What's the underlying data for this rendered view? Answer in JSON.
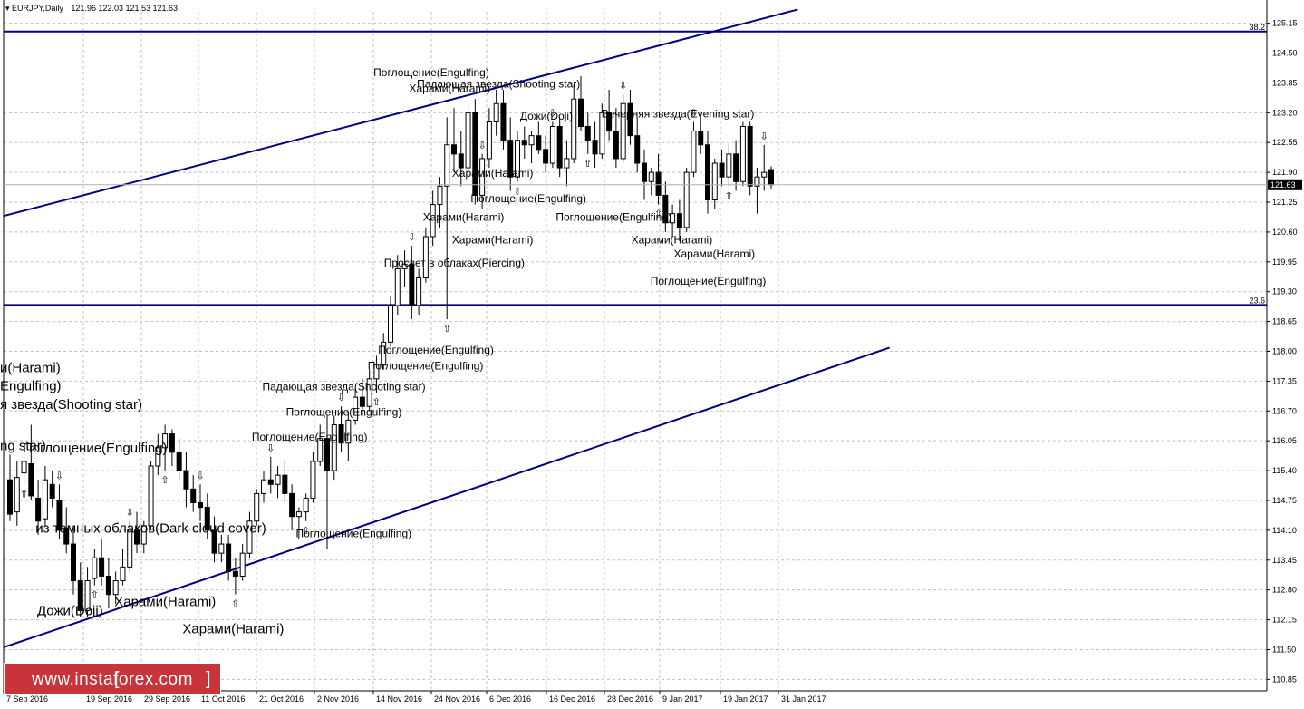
{
  "header": {
    "title": "EURJPY,Daily",
    "ohlc": "121.96 122.03 121.53 121.63"
  },
  "watermark": {
    "text": "www.instaforex.com",
    "left_bracket": "[",
    "right_bracket": "]"
  },
  "colors": {
    "bull": "#ffffff",
    "bear": "#000000",
    "line": "#000080",
    "grid": "#c0c0c0",
    "price_tag": "#000000"
  },
  "chart_data": {
    "type": "candlestick",
    "symbol": "EURJPY",
    "timeframe": "Daily",
    "ylim": [
      110.85,
      125.45
    ],
    "y_ticks": [
      "125.15",
      "124.50",
      "123.85",
      "123.20",
      "122.55",
      "121.90",
      "121.25",
      "120.60",
      "119.95",
      "119.30",
      "118.65",
      "118.00",
      "117.35",
      "116.70",
      "116.05",
      "115.40",
      "114.75",
      "114.10",
      "113.45",
      "112.80",
      "112.15",
      "111.50",
      "110.85"
    ],
    "x_labels": [
      "7 Sep 2016",
      "19 Sep 2016",
      "29 Sep 2016",
      "11 Oct 2016",
      "21 Oct 2016",
      "2 Nov 2016",
      "14 Nov 2016",
      "24 Nov 2016",
      "6 Dec 2016",
      "16 Dec 2016",
      "28 Dec 2016",
      "9 Jan 2017",
      "19 Jan 2017",
      "31 Jan 2017"
    ],
    "current_price": "121.63",
    "grid": true,
    "horizontal_levels": [
      {
        "label": "38.2",
        "price": 124.97
      },
      {
        "label": "23.6",
        "price": 119.01
      }
    ],
    "trend_lines": [
      {
        "from": [
          "7 Sep 2016",
          120.95
        ],
        "to": [
          "4 Feb 2017",
          125.45
        ],
        "name": "channel-upper"
      },
      {
        "from": [
          "7 Sep 2016",
          111.55
        ],
        "to": [
          "23 Feb 2017",
          118.08
        ],
        "name": "channel-lower"
      }
    ],
    "candles": [
      {
        "o": 115.2,
        "h": 115.75,
        "l": 114.3,
        "c": 114.45
      },
      {
        "o": 114.5,
        "h": 115.6,
        "l": 114.2,
        "c": 115.25
      },
      {
        "o": 115.35,
        "h": 116.05,
        "l": 115.1,
        "c": 115.6
      },
      {
        "o": 115.55,
        "h": 116.4,
        "l": 114.75,
        "c": 114.85
      },
      {
        "o": 114.8,
        "h": 115.2,
        "l": 114.0,
        "c": 114.3
      },
      {
        "o": 114.35,
        "h": 115.5,
        "l": 114.2,
        "c": 115.2
      },
      {
        "o": 115.1,
        "h": 115.4,
        "l": 114.6,
        "c": 114.8
      },
      {
        "o": 114.75,
        "h": 115.1,
        "l": 113.9,
        "c": 114.1
      },
      {
        "o": 114.15,
        "h": 114.6,
        "l": 113.6,
        "c": 113.8
      },
      {
        "o": 113.8,
        "h": 114.2,
        "l": 112.7,
        "c": 113.0
      },
      {
        "o": 113.0,
        "h": 113.4,
        "l": 112.2,
        "c": 112.35
      },
      {
        "o": 112.35,
        "h": 113.3,
        "l": 112.2,
        "c": 113.0
      },
      {
        "o": 113.05,
        "h": 113.7,
        "l": 112.9,
        "c": 113.5
      },
      {
        "o": 113.5,
        "h": 113.9,
        "l": 112.9,
        "c": 113.1
      },
      {
        "o": 113.1,
        "h": 113.5,
        "l": 112.4,
        "c": 112.7
      },
      {
        "o": 112.7,
        "h": 113.2,
        "l": 112.5,
        "c": 113.0
      },
      {
        "o": 113.0,
        "h": 113.7,
        "l": 112.9,
        "c": 113.3
      },
      {
        "o": 113.3,
        "h": 114.3,
        "l": 113.2,
        "c": 114.1
      },
      {
        "o": 114.1,
        "h": 114.5,
        "l": 113.6,
        "c": 113.8
      },
      {
        "o": 113.8,
        "h": 114.3,
        "l": 113.6,
        "c": 114.2
      },
      {
        "o": 114.2,
        "h": 115.6,
        "l": 114.1,
        "c": 115.5
      },
      {
        "o": 115.5,
        "h": 116.2,
        "l": 115.3,
        "c": 115.9
      },
      {
        "o": 115.9,
        "h": 116.4,
        "l": 115.4,
        "c": 116.2
      },
      {
        "o": 116.2,
        "h": 116.3,
        "l": 115.5,
        "c": 115.8
      },
      {
        "o": 115.8,
        "h": 116.1,
        "l": 115.2,
        "c": 115.4
      },
      {
        "o": 115.4,
        "h": 115.8,
        "l": 114.6,
        "c": 115.0
      },
      {
        "o": 115.0,
        "h": 115.3,
        "l": 114.5,
        "c": 114.7
      },
      {
        "o": 114.7,
        "h": 115.1,
        "l": 114.3,
        "c": 114.6
      },
      {
        "o": 114.6,
        "h": 114.9,
        "l": 113.9,
        "c": 114.1
      },
      {
        "o": 114.1,
        "h": 114.4,
        "l": 113.4,
        "c": 113.6
      },
      {
        "o": 113.6,
        "h": 114.0,
        "l": 113.4,
        "c": 113.8
      },
      {
        "o": 113.8,
        "h": 114.0,
        "l": 113.0,
        "c": 113.2
      },
      {
        "o": 113.2,
        "h": 113.5,
        "l": 112.7,
        "c": 113.1
      },
      {
        "o": 113.1,
        "h": 113.8,
        "l": 113.0,
        "c": 113.6
      },
      {
        "o": 113.6,
        "h": 114.5,
        "l": 113.5,
        "c": 114.3
      },
      {
        "o": 114.3,
        "h": 115.0,
        "l": 114.2,
        "c": 114.9
      },
      {
        "o": 114.9,
        "h": 115.4,
        "l": 114.7,
        "c": 115.2
      },
      {
        "o": 115.2,
        "h": 115.7,
        "l": 114.9,
        "c": 115.1
      },
      {
        "o": 115.1,
        "h": 115.5,
        "l": 114.8,
        "c": 115.3
      },
      {
        "o": 115.3,
        "h": 115.6,
        "l": 114.7,
        "c": 114.9
      },
      {
        "o": 114.9,
        "h": 115.1,
        "l": 114.1,
        "c": 114.4
      },
      {
        "o": 114.4,
        "h": 114.6,
        "l": 113.9,
        "c": 114.5
      },
      {
        "o": 114.5,
        "h": 114.9,
        "l": 114.3,
        "c": 114.8
      },
      {
        "o": 114.8,
        "h": 115.8,
        "l": 114.7,
        "c": 115.6
      },
      {
        "o": 115.6,
        "h": 116.4,
        "l": 115.5,
        "c": 116.1
      },
      {
        "o": 116.1,
        "h": 116.6,
        "l": 113.7,
        "c": 115.4
      },
      {
        "o": 115.4,
        "h": 116.6,
        "l": 115.2,
        "c": 116.4
      },
      {
        "o": 116.4,
        "h": 116.8,
        "l": 115.8,
        "c": 116.0
      },
      {
        "o": 116.0,
        "h": 116.7,
        "l": 115.6,
        "c": 116.5
      },
      {
        "o": 116.5,
        "h": 117.2,
        "l": 116.4,
        "c": 117.0
      },
      {
        "o": 117.0,
        "h": 117.4,
        "l": 116.6,
        "c": 116.8
      },
      {
        "o": 116.8,
        "h": 117.6,
        "l": 116.7,
        "c": 117.4
      },
      {
        "o": 117.4,
        "h": 117.9,
        "l": 117.1,
        "c": 117.7
      },
      {
        "o": 117.7,
        "h": 118.4,
        "l": 117.6,
        "c": 118.2
      },
      {
        "o": 118.2,
        "h": 119.2,
        "l": 118.1,
        "c": 119.0
      },
      {
        "o": 119.0,
        "h": 120.1,
        "l": 118.8,
        "c": 119.8
      },
      {
        "o": 119.8,
        "h": 120.2,
        "l": 119.4,
        "c": 119.9
      },
      {
        "o": 119.9,
        "h": 120.3,
        "l": 118.7,
        "c": 119.0
      },
      {
        "o": 119.0,
        "h": 119.8,
        "l": 118.8,
        "c": 119.6
      },
      {
        "o": 119.6,
        "h": 120.7,
        "l": 119.5,
        "c": 120.5
      },
      {
        "o": 120.5,
        "h": 121.5,
        "l": 120.3,
        "c": 121.2
      },
      {
        "o": 121.2,
        "h": 121.8,
        "l": 120.7,
        "c": 121.6
      },
      {
        "o": 121.6,
        "h": 123.1,
        "l": 118.7,
        "c": 122.5
      },
      {
        "o": 122.5,
        "h": 123.3,
        "l": 121.9,
        "c": 122.3
      },
      {
        "o": 122.3,
        "h": 122.8,
        "l": 121.6,
        "c": 122.0
      },
      {
        "o": 122.0,
        "h": 123.4,
        "l": 121.9,
        "c": 123.2
      },
      {
        "o": 123.2,
        "h": 123.5,
        "l": 121.2,
        "c": 121.4
      },
      {
        "o": 121.4,
        "h": 122.3,
        "l": 121.1,
        "c": 122.2
      },
      {
        "o": 122.2,
        "h": 123.3,
        "l": 122.0,
        "c": 123.0
      },
      {
        "o": 123.0,
        "h": 123.7,
        "l": 122.7,
        "c": 123.4
      },
      {
        "o": 123.4,
        "h": 123.7,
        "l": 122.4,
        "c": 122.6
      },
      {
        "o": 122.6,
        "h": 123.1,
        "l": 121.5,
        "c": 121.8
      },
      {
        "o": 121.8,
        "h": 122.8,
        "l": 121.7,
        "c": 122.6
      },
      {
        "o": 122.6,
        "h": 122.9,
        "l": 122.2,
        "c": 122.5
      },
      {
        "o": 122.5,
        "h": 122.8,
        "l": 122.1,
        "c": 122.7
      },
      {
        "o": 122.7,
        "h": 123.0,
        "l": 122.3,
        "c": 122.4
      },
      {
        "o": 122.4,
        "h": 122.7,
        "l": 121.9,
        "c": 122.1
      },
      {
        "o": 122.1,
        "h": 123.0,
        "l": 122.0,
        "c": 122.9
      },
      {
        "o": 122.9,
        "h": 123.1,
        "l": 121.8,
        "c": 122.0
      },
      {
        "o": 122.0,
        "h": 122.6,
        "l": 121.6,
        "c": 122.2
      },
      {
        "o": 122.2,
        "h": 123.8,
        "l": 122.1,
        "c": 123.5
      },
      {
        "o": 123.5,
        "h": 124.0,
        "l": 122.8,
        "c": 122.9
      },
      {
        "o": 122.9,
        "h": 123.2,
        "l": 122.3,
        "c": 122.6
      },
      {
        "o": 122.6,
        "h": 123.0,
        "l": 122.0,
        "c": 122.3
      },
      {
        "o": 122.3,
        "h": 123.4,
        "l": 122.2,
        "c": 123.2
      },
      {
        "o": 123.2,
        "h": 123.7,
        "l": 122.6,
        "c": 122.8
      },
      {
        "o": 122.8,
        "h": 123.3,
        "l": 122.0,
        "c": 122.2
      },
      {
        "o": 122.2,
        "h": 123.6,
        "l": 122.1,
        "c": 123.4
      },
      {
        "o": 123.4,
        "h": 123.7,
        "l": 122.5,
        "c": 122.7
      },
      {
        "o": 122.7,
        "h": 123.1,
        "l": 121.9,
        "c": 122.1
      },
      {
        "o": 122.1,
        "h": 122.4,
        "l": 121.3,
        "c": 121.7
      },
      {
        "o": 121.7,
        "h": 122.0,
        "l": 121.4,
        "c": 121.9
      },
      {
        "o": 121.9,
        "h": 122.3,
        "l": 121.2,
        "c": 121.4
      },
      {
        "o": 121.4,
        "h": 121.7,
        "l": 120.6,
        "c": 120.8
      },
      {
        "o": 120.8,
        "h": 121.2,
        "l": 120.5,
        "c": 121.0
      },
      {
        "o": 121.0,
        "h": 121.3,
        "l": 120.4,
        "c": 120.7
      },
      {
        "o": 120.7,
        "h": 122.0,
        "l": 120.6,
        "c": 121.9
      },
      {
        "o": 121.9,
        "h": 123.0,
        "l": 121.8,
        "c": 122.8
      },
      {
        "o": 122.8,
        "h": 123.1,
        "l": 122.3,
        "c": 122.5
      },
      {
        "o": 122.5,
        "h": 122.8,
        "l": 121.0,
        "c": 121.3
      },
      {
        "o": 121.3,
        "h": 122.2,
        "l": 121.1,
        "c": 122.1
      },
      {
        "o": 122.1,
        "h": 122.4,
        "l": 121.6,
        "c": 121.8
      },
      {
        "o": 121.8,
        "h": 122.5,
        "l": 121.6,
        "c": 122.3
      },
      {
        "o": 122.3,
        "h": 122.6,
        "l": 121.5,
        "c": 121.7
      },
      {
        "o": 121.7,
        "h": 123.0,
        "l": 121.6,
        "c": 122.9
      },
      {
        "o": 122.9,
        "h": 123.0,
        "l": 121.4,
        "c": 121.6
      },
      {
        "o": 121.6,
        "h": 122.0,
        "l": 121.0,
        "c": 121.8
      },
      {
        "o": 121.8,
        "h": 122.5,
        "l": 121.5,
        "c": 121.9
      },
      {
        "o": 121.96,
        "h": 122.03,
        "l": 121.53,
        "c": 121.63
      }
    ],
    "pattern_labels": [
      {
        "text": "Поглощение(Engulfing)",
        "x": "24 Nov 2016",
        "price": 124.0
      },
      {
        "text": "Падающая звезда(Shooting star)",
        "x": "8 Dec 2016",
        "price": 123.75
      },
      {
        "text": "Харами(Harami)",
        "x": "28 Nov 2016",
        "price": 123.65
      },
      {
        "text": "Дожи(Doji)",
        "x": "16 Dec 2016",
        "price": 123.05
      },
      {
        "text": "Вечерняя звезда(Evening star)",
        "x": "12 Jan 2017",
        "price": 123.1
      },
      {
        "text": "Харами(Harami)",
        "x": "7 Dec 2016",
        "price": 121.8
      },
      {
        "text": "Поглощение(Engulfing)",
        "x": "13 Dec 2016",
        "price": 121.25
      },
      {
        "text": "Харами(Harami)",
        "x": "1 Dec 2016",
        "price": 120.85
      },
      {
        "text": "Поглощение(Engulfing)",
        "x": "30 Dec 2016",
        "price": 120.85
      },
      {
        "text": "Харами(Harami)",
        "x": "7 Dec 2016",
        "price": 120.35
      },
      {
        "text": "Харами(Harami)",
        "x": "11 Jan 2017",
        "price": 120.35
      },
      {
        "text": "Харами(Harami)",
        "x": "18 Jan 2017",
        "price": 120.05
      },
      {
        "text": "Просвет в облаках(Piercing)",
        "x": "29 Nov 2016",
        "price": 119.85
      },
      {
        "text": "Поглощение(Engulfing)",
        "x": "17 Jan 2017",
        "price": 119.45
      },
      {
        "text": "Поглощение(Engulfing)",
        "x": "25 Nov 2016",
        "price": 117.95
      },
      {
        "text": "Поглощение(Engulfing)",
        "x": "23 Nov 2016",
        "price": 117.6
      },
      {
        "text": "Падающая звезда(Shooting star)",
        "x": "8 Nov 2016",
        "price": 117.15
      },
      {
        "text": "Поглощение(Engulfing)",
        "x": "8 Nov 2016",
        "price": 116.6
      },
      {
        "text": "Поглощение(Engulfing)",
        "x": "1 Nov 2016",
        "price": 116.05
      },
      {
        "text": "Поглощение(Engulfing)",
        "x": "10 Nov 2016",
        "price": 113.95
      },
      {
        "text": "Харами(Harami)",
        "x": "17 Oct 2016",
        "price": 111.85
      },
      {
        "text": "Харами(Harami)",
        "x": "4 Oct 2016",
        "price": 112.45
      },
      {
        "text": "Дожи(Doji)",
        "x": "17 Sep 2016",
        "price": 112.25
      },
      {
        "text": "из темных облаков(Dark cloud cover)",
        "x": "1 Oct 2016",
        "price": 114.05
      },
      {
        "text": "Поглощение(Engulfing)",
        "x": "21 Sep 2016",
        "price": 115.8
      },
      {
        "text": "ng star)",
        "x": "7 Sep 2016",
        "price": 115.85
      },
      {
        "text": "я звезда(Shooting star)",
        "x": "14 Sep 2016",
        "price": 116.75
      },
      {
        "text": "Engulfing)",
        "x": "9 Sep 2016",
        "price": 117.15
      },
      {
        "text": "и(Harami)",
        "x": "8 Sep 2016",
        "price": 117.55
      }
    ]
  }
}
